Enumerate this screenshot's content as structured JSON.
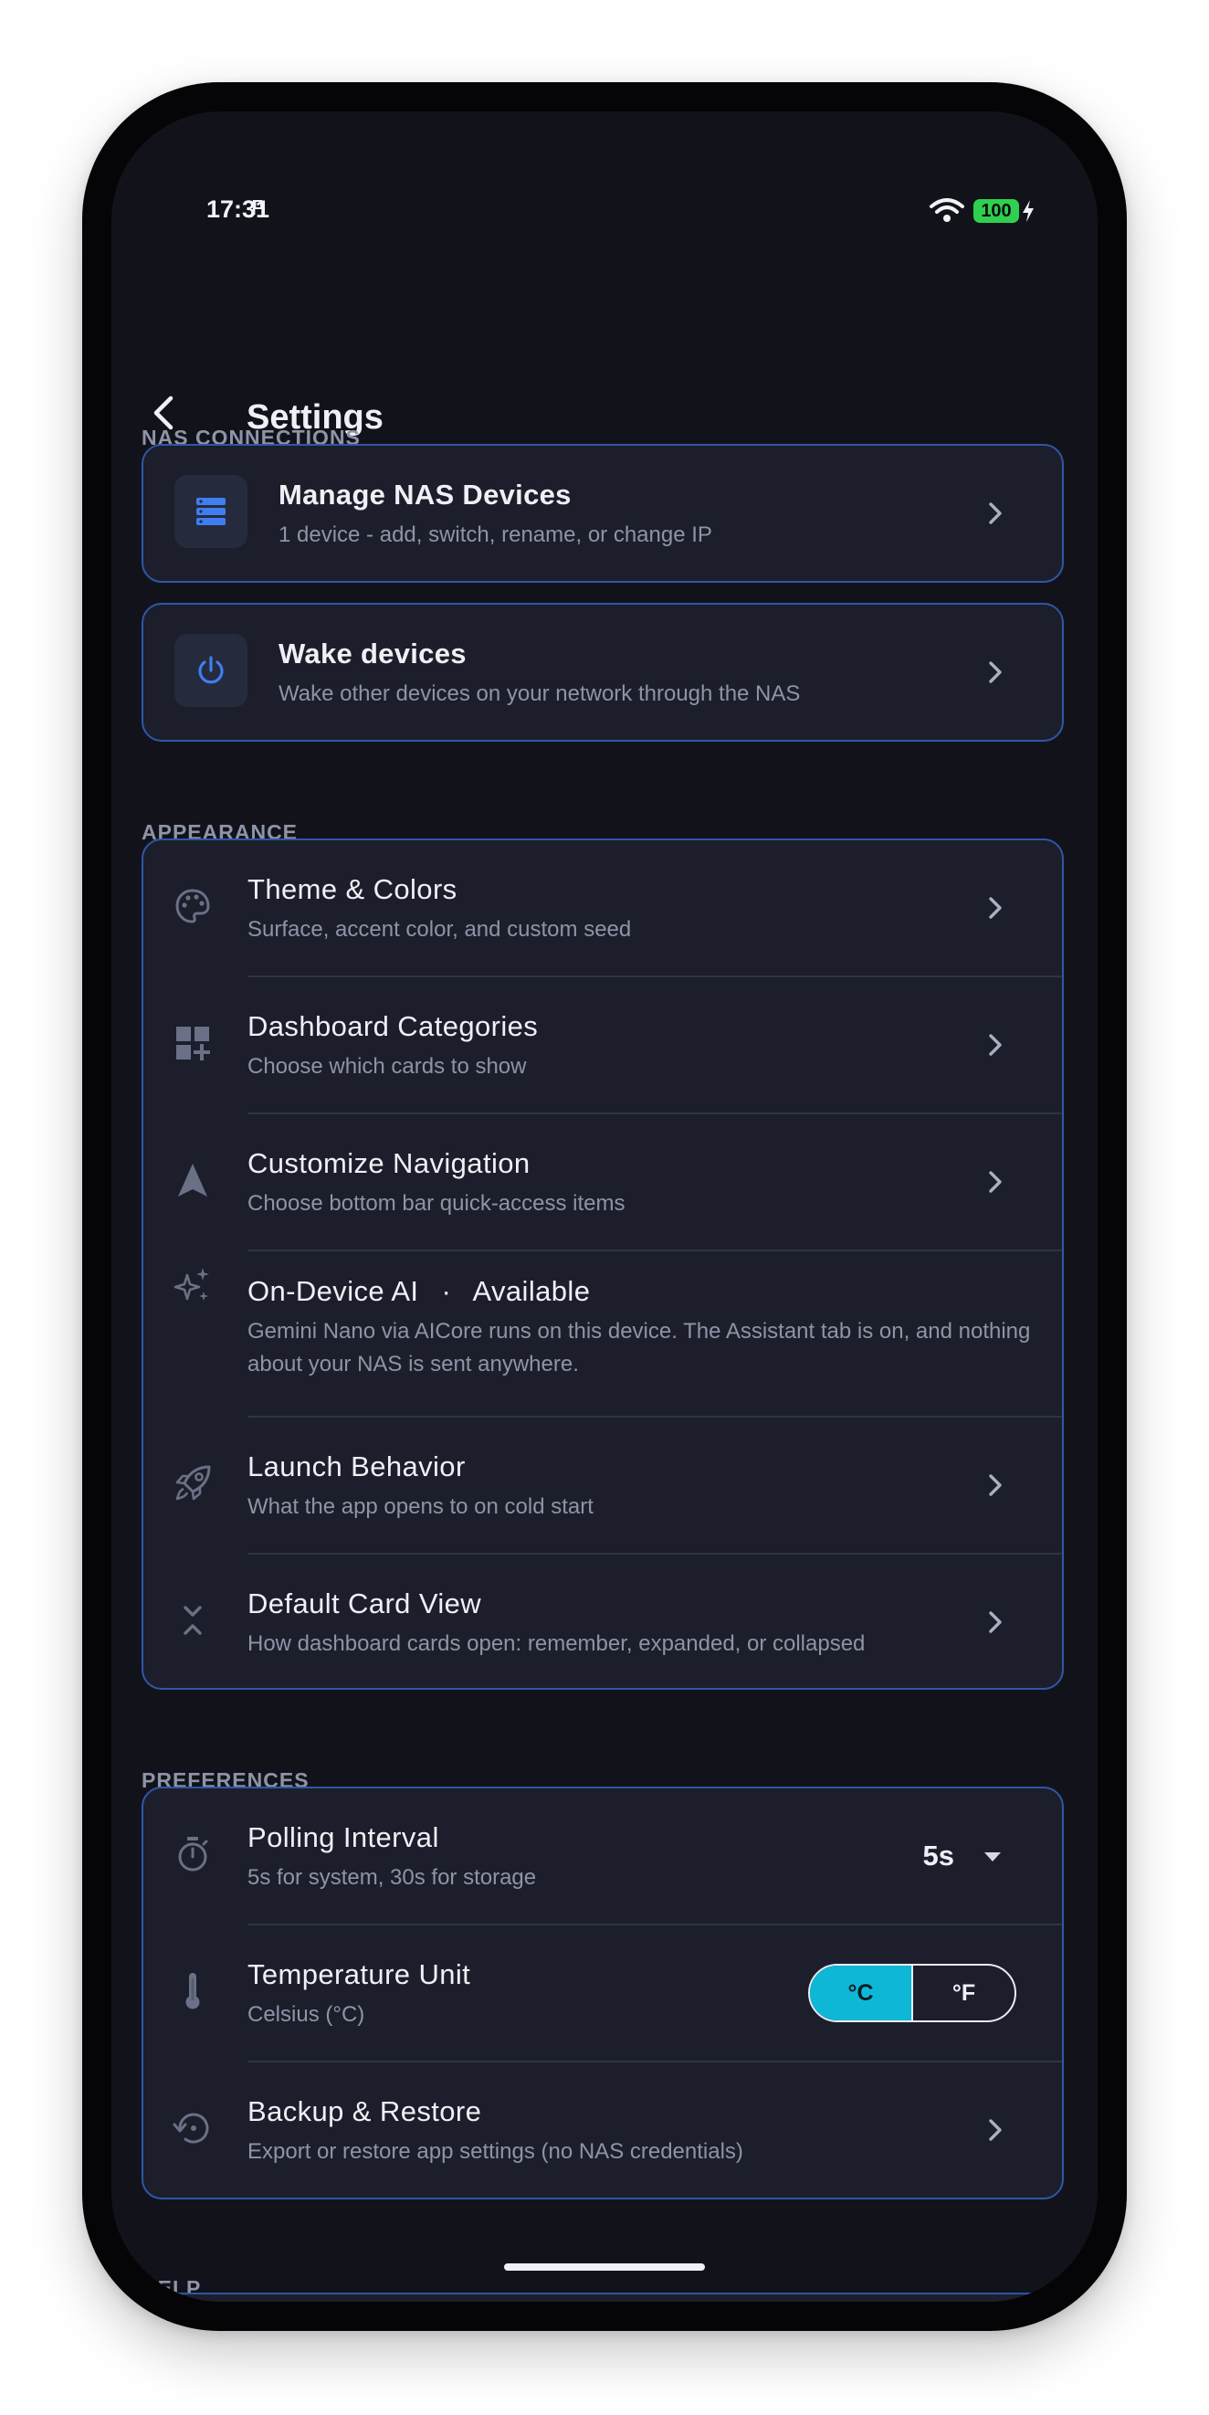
{
  "status_bar": {
    "time": "17:31",
    "battery": "100"
  },
  "header": {
    "title": "Settings"
  },
  "sections": {
    "nas_connections": "NAS CONNECTIONS",
    "appearance": "APPEARANCE",
    "preferences": "PREFERENCES",
    "help": "HELP"
  },
  "nas": {
    "manage": {
      "title": "Manage NAS Devices",
      "subtitle": "1 device - add, switch, rename, or change IP"
    },
    "wake": {
      "title": "Wake devices",
      "subtitle": "Wake other devices on your network through the NAS"
    }
  },
  "appearance": {
    "theme": {
      "title": "Theme & Colors",
      "subtitle": "Surface, accent color, and custom seed"
    },
    "dashboard": {
      "title": "Dashboard Categories",
      "subtitle": "Choose which cards to show"
    },
    "navigation": {
      "title": "Customize Navigation",
      "subtitle": "Choose bottom bar quick-access items"
    },
    "ai": {
      "title": "On-Device AI",
      "separator": "·",
      "status": "Available",
      "subtitle": "Gemini Nano via AICore runs on this device. The Assistant tab is on, and nothing about your NAS is sent anywhere."
    },
    "launch": {
      "title": "Launch Behavior",
      "subtitle": "What the app opens to on cold start"
    },
    "cardview": {
      "title": "Default Card View",
      "subtitle": "How dashboard cards open: remember, expanded, or collapsed"
    }
  },
  "preferences": {
    "polling": {
      "title": "Polling Interval",
      "subtitle": "5s for system, 30s for storage",
      "value": "5s"
    },
    "temperature": {
      "title": "Temperature Unit",
      "subtitle": "Celsius (°C)",
      "options": [
        "°C",
        "°F"
      ],
      "selected": "°C"
    },
    "backup": {
      "title": "Backup & Restore",
      "subtitle": "Export or restore app settings (no NAS credentials)"
    }
  },
  "colors": {
    "background": "#12131a",
    "card": "#1c1e2b",
    "card_border": "#2f56a8",
    "accent": "#0fb7d6",
    "icon_blue": "#3f7ef0",
    "muted_text": "#8e94a8"
  },
  "icons": {
    "back": "back-arrow-icon",
    "nas": "server-icon",
    "wake": "power-icon",
    "theme": "palette-icon",
    "dashboard": "dashboard-add-icon",
    "navigation": "navigation-arrow-icon",
    "ai": "sparkle-icon",
    "launch": "rocket-icon",
    "cardview": "collapse-icon",
    "polling": "timer-icon",
    "temperature": "thermometer-icon",
    "backup": "restore-icon"
  }
}
